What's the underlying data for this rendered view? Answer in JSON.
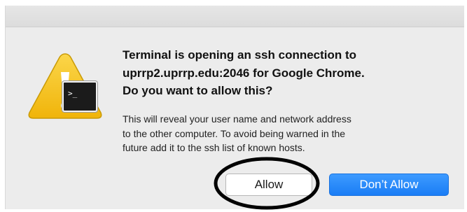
{
  "dialog": {
    "title_lines": [
      "Terminal is opening an ssh connection to",
      "uprrp2.uprrp.edu:2046 for Google Chrome.",
      "Do you want to allow this?"
    ],
    "message_lines": [
      "This will reveal your user name and network address",
      "to the other computer. To avoid being warned in the",
      "future add it to the ssh list of known hosts."
    ],
    "icon": "caution-icon",
    "app_badge_icon": "terminal-icon",
    "app_badge_text": ">_"
  },
  "buttons": {
    "allow_label": "Allow",
    "deny_label": "Don’t Allow"
  },
  "colors": {
    "warning_yellow": "#f7c21a",
    "default_button_blue": "#1a7df5",
    "annotation_ring": "#000000"
  }
}
